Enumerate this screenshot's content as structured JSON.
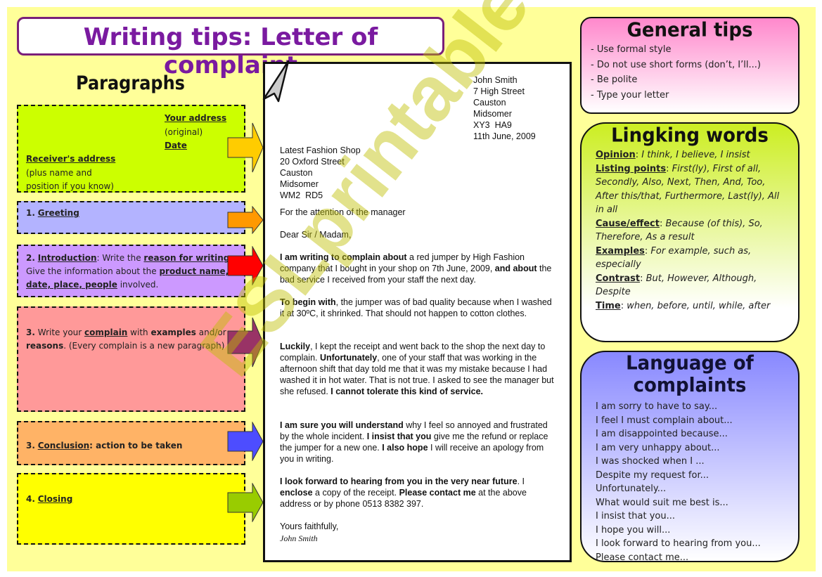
{
  "title": "Writing tips: Letter of complaint",
  "paragraphs": {
    "heading": "Paragraphs",
    "address_box": {
      "your_address": "Your address",
      "original": "(original)",
      "date": "Date",
      "receivers_address": "Receiver's address",
      "receiver_note_1": "(plus name and",
      "receiver_note_2": "position if you know)"
    },
    "greeting": {
      "num": "1.",
      "label": "Greeting"
    },
    "introduction": {
      "num": "2.",
      "label": "Introduction",
      "t1": ": Write the ",
      "reason": "reason for writing",
      "t2": ". Give the information about the ",
      "details": "product name, date, place, people",
      "t3": " involved."
    },
    "complain": {
      "num": "3.",
      "t1": " Write your ",
      "complain": "complain",
      "t2": " with ",
      "examples": "examples",
      "t3": " and/or ",
      "reasons": "reasons",
      "t4": ". (Every complain is a new paragraph)"
    },
    "conclusion": {
      "num": "3.",
      "label": "Conclusion",
      "t1": ": action to be taken"
    },
    "closing": {
      "num": "4.",
      "label": "Closing"
    },
    "colors": {
      "address": "#ccff00",
      "greeting": "#b3b3ff",
      "introduction": "#cc99ff",
      "complain": "#ff9999",
      "conclusion": "#ffb366",
      "closing": "#ffff00"
    },
    "arrow_colors": [
      "#ffcc00",
      "#ff9900",
      "#ff0000",
      "#993366",
      "#3333ff",
      "#99cc00"
    ]
  },
  "letter": {
    "sender": [
      "John Smith",
      "7 High Street",
      "Causton",
      "Midsomer",
      "XY3  HA9",
      "11th June, 2009"
    ],
    "receiver": [
      "Latest Fashion Shop",
      "20 Oxford Street",
      "Causton",
      "Midsomer",
      "WM2  RD5"
    ],
    "attention": "For the attention of the manager",
    "salutation": "Dear Sir / Madam,",
    "p1": {
      "b1": "I am writing to complain about",
      "t1": " a red jumper by High Fashion company that I bought in your shop on 7th June, 2009, ",
      "b2": "and about",
      "t2": " the bad service I received from your staff the next day."
    },
    "p2": {
      "b1": "To begin with",
      "t1": ", the jumper was of bad quality because when I washed it at 30ºC, it shrinked. That should not happen to cotton clothes."
    },
    "p3": {
      "b1": "Luckily",
      "t1": ", I kept the receipt and went back to the shop the next day to complain. ",
      "b2": "Unfortunately",
      "t2": ", one of your staff that was working in the afternoon shift that day told me that it was my mistake because I had washed it in hot water. That is not true. I asked to see the manager but she refused. ",
      "b3": "I cannot tolerate this kind of service."
    },
    "p4": {
      "b1": "I am sure you will understand",
      "t1": " why I feel so annoyed and frustrated by the whole incident. ",
      "b2": "I insist that you",
      "t2": " give me the refund or replace the jumper for a new one. ",
      "b3": "I also hope",
      "t3": " I will receive an apology from you in writing."
    },
    "p5": {
      "b1": "I look forward to hearing from you in the very near future",
      "t1": ". I ",
      "b2": "enclose",
      "t2": " a copy of the receipt. ",
      "b3": "Please contact me",
      "t3": " at the above address or by phone 0513 8382 397."
    },
    "closing": "Yours faithfully,",
    "signature": "John Smith"
  },
  "general_tips": {
    "title": "General tips",
    "items": [
      "- Use formal style",
      "- Do not use short forms (don’t, I’ll...)",
      "- Be polite",
      "- Type your letter"
    ]
  },
  "linking_words": {
    "title": "Lingking words",
    "items": [
      {
        "label": "Opinion",
        "words": "I think, I believe, I insist"
      },
      {
        "label": "Listing points",
        "words": "First(ly), First of all, Secondly, Also, Next, Then, And, Too, After this/that, Furthermore, Last(ly), All in all"
      },
      {
        "label": "Cause/effect",
        "words": "Because (of this), So, Therefore, As a result"
      },
      {
        "label": "Examples",
        "words": "For example, such as, especially"
      },
      {
        "label": "Contrast",
        "words": "But, However, Although, Despite"
      },
      {
        "label": "Time",
        "words": "when, before, until, while, after"
      }
    ]
  },
  "language_of_complaints": {
    "title": "Language of complaints",
    "items": [
      "I am sorry to have to say...",
      "I feel I must complain about...",
      "I am disappointed because...",
      "I am very unhappy about...",
      "I was shocked when I ...",
      "Despite my request for...",
      "Unfortunately...",
      "What would suit me best is...",
      "I insist that you...",
      "I hope you will...",
      "I look forward to hearing from you...",
      "Please contact me..."
    ]
  },
  "watermark": "ESLprintables.com"
}
